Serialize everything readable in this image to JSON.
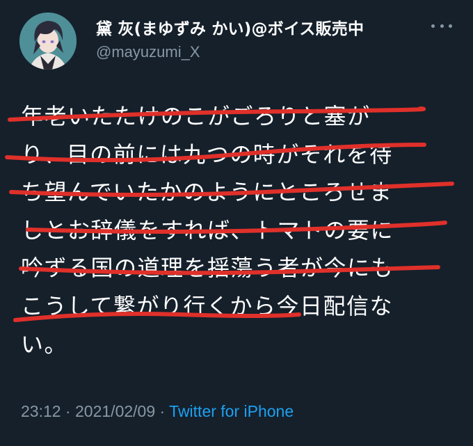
{
  "author": {
    "display_name": "黛 灰(まゆずみ かい)@ボイス販売中",
    "handle": "@mayuzumi_X"
  },
  "tweet": {
    "lines": [
      "年老いたたけのこがごろりと塞が",
      "り、目の前には九つの時がそれを待",
      "ち望んでいたかのようにところせま",
      "しとお辞儀をすれば、トマトの要に",
      "吟ずる国の道理を揺蕩う者が今にも",
      "こうして繋がり行くから今日配信な",
      "い。"
    ]
  },
  "meta": {
    "time": "23:12",
    "separator1": " · ",
    "date": "2021/02/09",
    "separator2": " · ",
    "source": "Twitter for iPhone"
  },
  "colors": {
    "background": "#15202b",
    "text": "#ffffff",
    "secondary": "#8899a6",
    "link": "#1da1f2",
    "strike": "#e0302a"
  }
}
